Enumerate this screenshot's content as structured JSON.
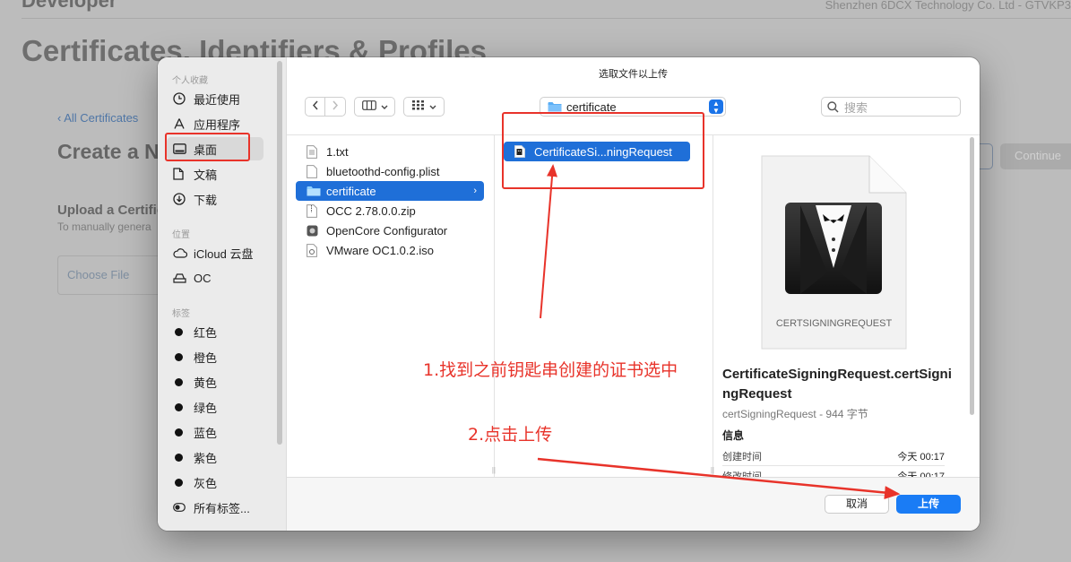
{
  "background": {
    "brand": "Developer",
    "company": "Shenzhen 6DCX Technology Co. Ltd - GTVKP3",
    "page_title": "Certificates, Identifiers & Profiles",
    "back_link": "‹ All Certificates",
    "section_title": "Create a N",
    "upload_heading": "Upload a Certific",
    "upload_desc": "To manually genera",
    "choose_file": "Choose File",
    "continue_label": "Continue"
  },
  "dialog": {
    "title": "选取文件以上传",
    "sidebar": {
      "sections": [
        {
          "label": "个人收藏",
          "items": [
            {
              "label": "最近使用",
              "icon": "clock-icon"
            },
            {
              "label": "应用程序",
              "icon": "applications-icon"
            },
            {
              "label": "桌面",
              "icon": "desktop-icon",
              "selected": true
            },
            {
              "label": "文稿",
              "icon": "document-icon"
            },
            {
              "label": "下载",
              "icon": "download-icon"
            }
          ]
        },
        {
          "label": "位置",
          "items": [
            {
              "label": "iCloud 云盘",
              "icon": "cloud-icon"
            },
            {
              "label": "OC",
              "icon": "disk-icon"
            }
          ]
        },
        {
          "label": "标签",
          "items": [
            {
              "label": "红色",
              "icon": "tag-dot-icon"
            },
            {
              "label": "橙色",
              "icon": "tag-dot-icon"
            },
            {
              "label": "黄色",
              "icon": "tag-dot-icon"
            },
            {
              "label": "绿色",
              "icon": "tag-dot-icon"
            },
            {
              "label": "蓝色",
              "icon": "tag-dot-icon"
            },
            {
              "label": "紫色",
              "icon": "tag-dot-icon"
            },
            {
              "label": "灰色",
              "icon": "tag-dot-icon"
            },
            {
              "label": "所有标签...",
              "icon": "all-tags-icon"
            }
          ]
        }
      ]
    },
    "toolbar": {
      "current_folder": "certificate",
      "search_placeholder": "搜索"
    },
    "columns": {
      "desktop_files": [
        {
          "name": "1.txt",
          "icon": "text-file-icon"
        },
        {
          "name": "bluetoothd-config.plist",
          "icon": "plist-file-icon"
        },
        {
          "name": "certificate",
          "icon": "folder-icon",
          "selected": true
        },
        {
          "name": "OCC 2.78.0.0.zip",
          "icon": "zip-file-icon"
        },
        {
          "name": "OpenCore Configurator",
          "icon": "app-icon"
        },
        {
          "name": "VMware OC1.0.2.iso",
          "icon": "iso-file-icon"
        }
      ],
      "certificate_files": [
        {
          "name": "CertificateSi...ningRequest",
          "icon": "csr-file-icon",
          "selected": true
        }
      ]
    },
    "preview": {
      "badge": "CERTSIGNINGREQUEST",
      "name": "CertificateSigningRequest.certSigningRequest",
      "meta": "certSigningRequest - 944 字节",
      "info_heading": "信息",
      "rows": [
        {
          "label": "创建时间",
          "value": "今天 00:17"
        },
        {
          "label": "修改时间",
          "value": "今天 00:17"
        }
      ]
    },
    "buttons": {
      "cancel": "取消",
      "upload": "上传"
    }
  },
  "annotations": {
    "step1": "1.找到之前钥匙串创建的证书选中",
    "step2": "2.点击上传",
    "color": "#e8332a"
  }
}
